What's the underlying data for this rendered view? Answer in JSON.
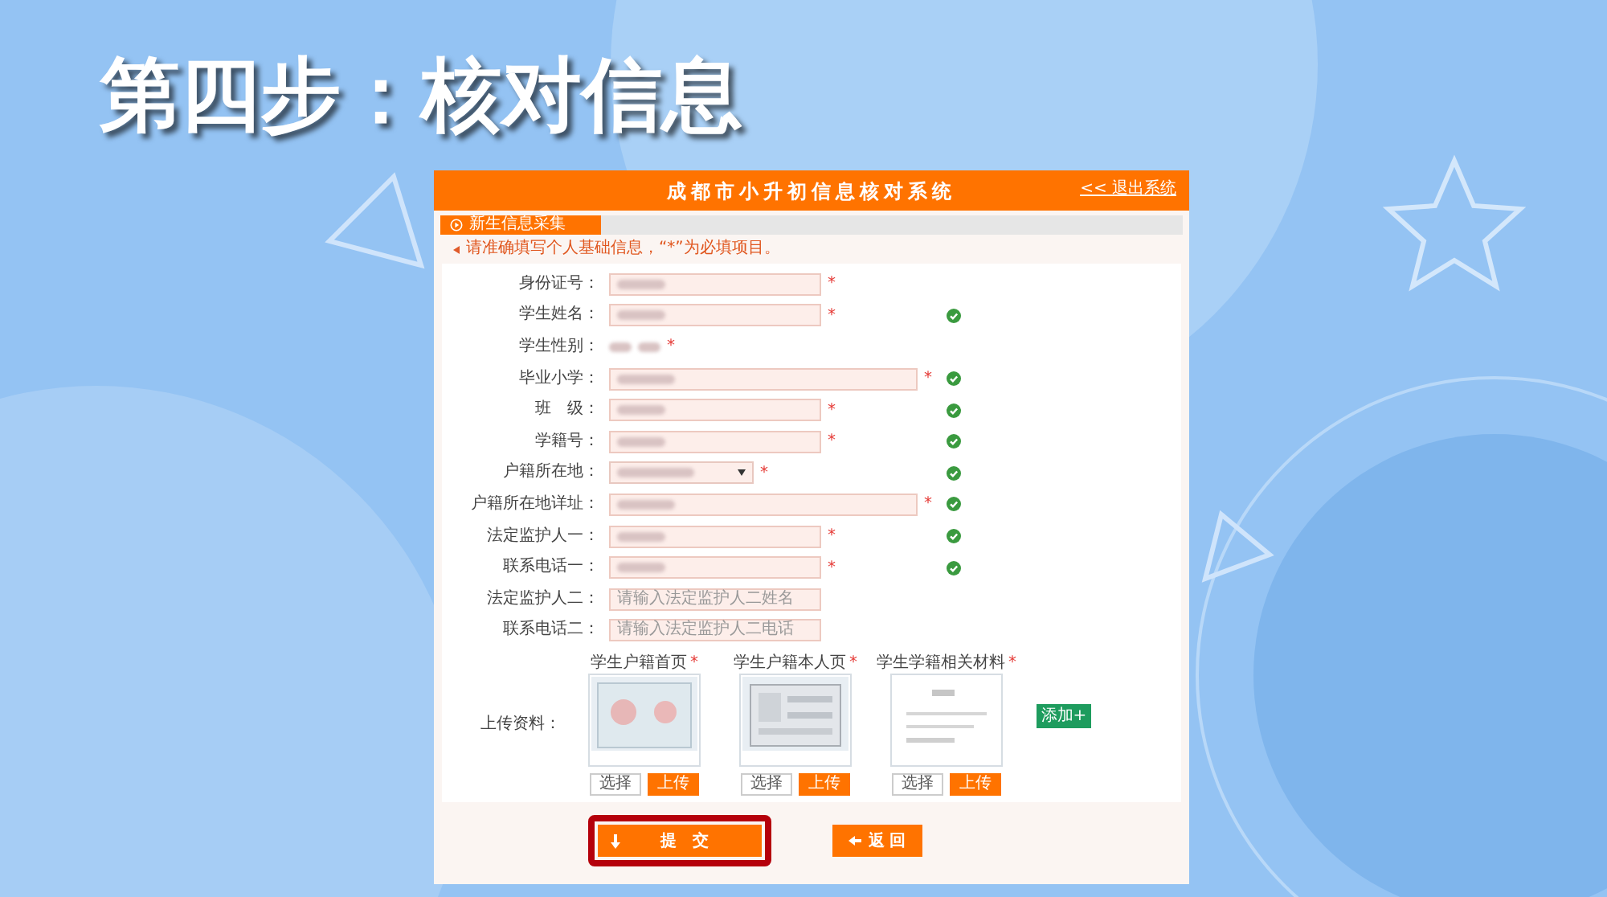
{
  "slide_title": "第四步：核对信息",
  "app": {
    "title": "成都市小升初信息核对系统",
    "exit_link": "<< 退出系统",
    "section_tab": "新生信息采集",
    "notice": "请准确填写个人基础信息，“*”为必填项目。",
    "fields": [
      {
        "label": "身份证号：",
        "kind": "text",
        "filled": true,
        "required_mark": "*",
        "verified": false
      },
      {
        "label": "学生姓名：",
        "kind": "text",
        "filled": true,
        "required_mark": "*",
        "verified": true
      },
      {
        "label": "学生性别：",
        "kind": "radio",
        "filled": true,
        "required_mark": "*",
        "verified": false
      },
      {
        "label": "毕业小学：",
        "kind": "wide",
        "filled": true,
        "required_mark": "*",
        "verified": true
      },
      {
        "label": "班　级：",
        "kind": "text",
        "filled": true,
        "required_mark": "*",
        "verified": true
      },
      {
        "label": "学籍号：",
        "kind": "text",
        "filled": true,
        "required_mark": "*",
        "verified": true
      },
      {
        "label": "户籍所在地：",
        "kind": "select",
        "filled": true,
        "required_mark": "*",
        "verified": true
      },
      {
        "label": "户籍所在地详址：",
        "kind": "wide",
        "filled": true,
        "required_mark": "*",
        "verified": true
      },
      {
        "label": "法定监护人一：",
        "kind": "text",
        "filled": true,
        "required_mark": "*",
        "verified": true
      },
      {
        "label": "联系电话一：",
        "kind": "text",
        "filled": true,
        "required_mark": "*",
        "verified": true
      },
      {
        "label": "法定监护人二：",
        "kind": "text",
        "filled": false,
        "placeholder": "请输入法定监护人二姓名",
        "verified": false
      },
      {
        "label": "联系电话二：",
        "kind": "text",
        "filled": false,
        "placeholder": "请输入法定监护人二电话",
        "verified": false
      }
    ],
    "upload_label": "上传资料：",
    "uploads": [
      {
        "label": "学生户籍首页",
        "required_mark": "*",
        "kind": "picture",
        "choose": "选择",
        "upload": "上传"
      },
      {
        "label": "学生户籍本人页",
        "required_mark": "*",
        "kind": "picture",
        "choose": "选择",
        "upload": "上传"
      },
      {
        "label": "学生学籍相关材料",
        "required_mark": "*",
        "kind": "picture",
        "choose": "选择",
        "upload": "上传"
      }
    ],
    "add_button": "添加+",
    "submit": {
      "label": "提　交",
      "highlighted": true
    },
    "back": {
      "label": "返 回"
    }
  }
}
